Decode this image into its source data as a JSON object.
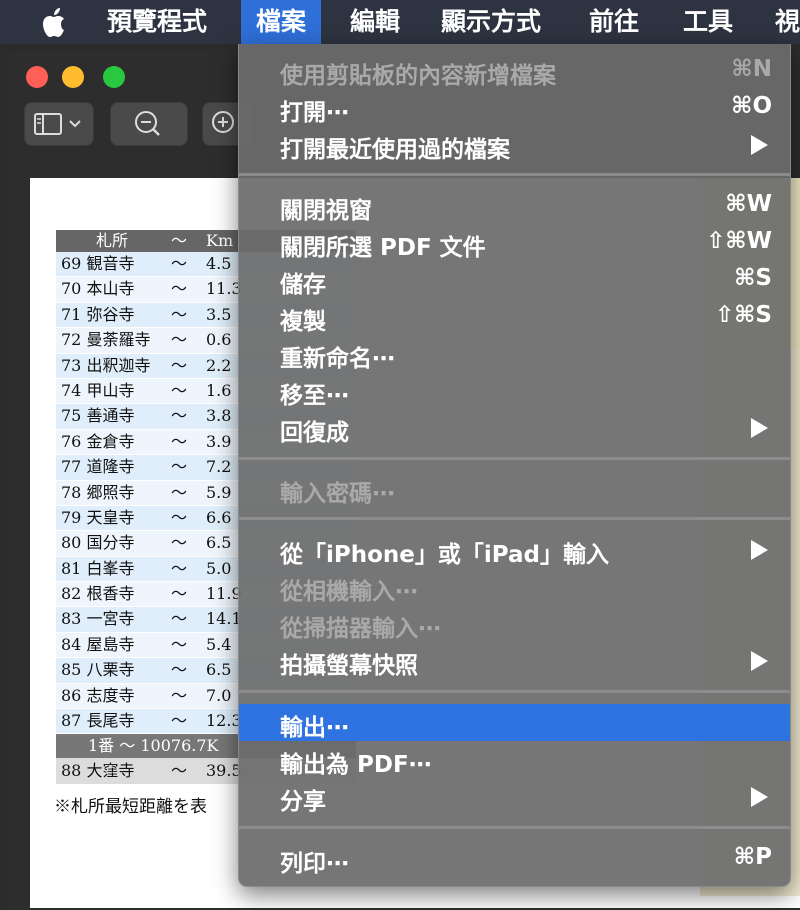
{
  "menubar": {
    "items": [
      "預覽程式",
      "檔案",
      "編輯",
      "顯示方式",
      "前往",
      "工具",
      "視"
    ]
  },
  "document": {
    "table_header": [
      "札所",
      "～",
      "Km"
    ],
    "rows": [
      [
        "69 観音寺",
        "～",
        "4.5"
      ],
      [
        "70 本山寺",
        "～",
        "11.3"
      ],
      [
        "71 弥谷寺",
        "～",
        "3.5"
      ],
      [
        "72 曼荼羅寺",
        "～",
        "0.6"
      ],
      [
        "73 出釈迦寺",
        "～",
        "2.2"
      ],
      [
        "74 甲山寺",
        "～",
        "1.6"
      ],
      [
        "75 善通寺",
        "～",
        "3.8"
      ],
      [
        "76 金倉寺",
        "～",
        "3.9"
      ],
      [
        "77 道隆寺",
        "～",
        "7.2"
      ],
      [
        "78 郷照寺",
        "～",
        "5.9"
      ],
      [
        "79 天皇寺",
        "～",
        "6.6"
      ],
      [
        "80 国分寺",
        "～",
        "6.5"
      ],
      [
        "81 白峯寺",
        "～",
        "5.0"
      ],
      [
        "82 根香寺",
        "～",
        "11.9"
      ],
      [
        "83 一宮寺",
        "～",
        "14.1"
      ],
      [
        "84 屋島寺",
        "～",
        "5.4"
      ],
      [
        "85 八栗寺",
        "～",
        "6.5"
      ],
      [
        "86 志度寺",
        "～",
        "7.0"
      ],
      [
        "87 長尾寺",
        "～",
        "12.3"
      ]
    ],
    "total_row": "1番 ～ 10076.7K",
    "extra_row": [
      "88 大窪寺",
      "～",
      "39.5"
    ],
    "note": "※札所最短距離を表"
  },
  "menu": {
    "items": [
      {
        "label": "使用剪貼板的內容新增檔案",
        "shortcut": "⌘N",
        "disabled": true
      },
      {
        "label": "打開⋯",
        "shortcut": "⌘O"
      },
      {
        "label": "打開最近使用過的檔案",
        "submenu": true
      },
      {
        "label": "關閉視窗",
        "shortcut": "⌘W"
      },
      {
        "label": "關閉所選 PDF 文件",
        "shortcut": "⇧⌘W"
      },
      {
        "label": "儲存",
        "shortcut": "⌘S"
      },
      {
        "label": "複製",
        "shortcut": "⇧⌘S"
      },
      {
        "label": "重新命名⋯"
      },
      {
        "label": "移至⋯"
      },
      {
        "label": "回復成",
        "submenu": true
      },
      {
        "label": "輸入密碼⋯",
        "disabled": true
      },
      {
        "label": "從「iPhone」或「iPad」輸入",
        "submenu": true
      },
      {
        "label": "從相機輸入⋯",
        "disabled": true
      },
      {
        "label": "從掃描器輸入⋯",
        "disabled": true
      },
      {
        "label": "拍攝螢幕快照",
        "submenu": true
      },
      {
        "label": "輸出⋯",
        "highlighted": true
      },
      {
        "label": "輸出為 PDF⋯"
      },
      {
        "label": "分享",
        "submenu": true
      },
      {
        "label": "列印⋯",
        "shortcut": "⌘P"
      }
    ]
  },
  "colors": {
    "menubar_bg": "#2d3340",
    "menu_highlight": "#2f73e0",
    "close": "#fe5f57",
    "minimize": "#febc2e",
    "zoom": "#28c840"
  }
}
